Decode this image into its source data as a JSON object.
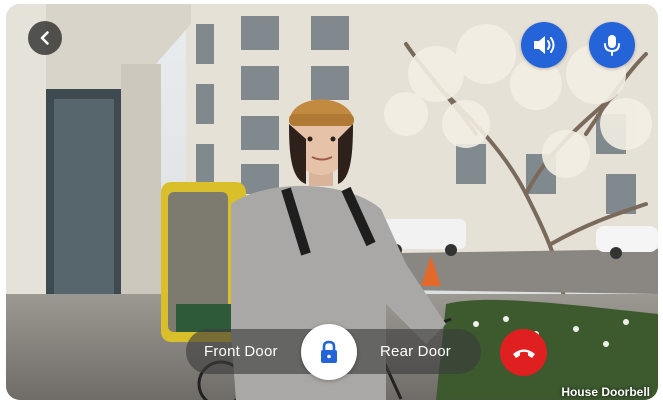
{
  "controls": {
    "front_door_label": "Front Door",
    "rear_door_label": "Rear Door"
  },
  "camera": {
    "name": "House Doorbell"
  },
  "icons": {
    "back": "chevron-left-icon",
    "speaker": "speaker-icon",
    "microphone": "microphone-icon",
    "lock": "lock-icon",
    "hang_up": "phone-hangup-icon"
  },
  "colors": {
    "accent_blue": "#2563d9",
    "hang_up_red": "#e02020",
    "overlay_dark": "#3c3c3c"
  }
}
